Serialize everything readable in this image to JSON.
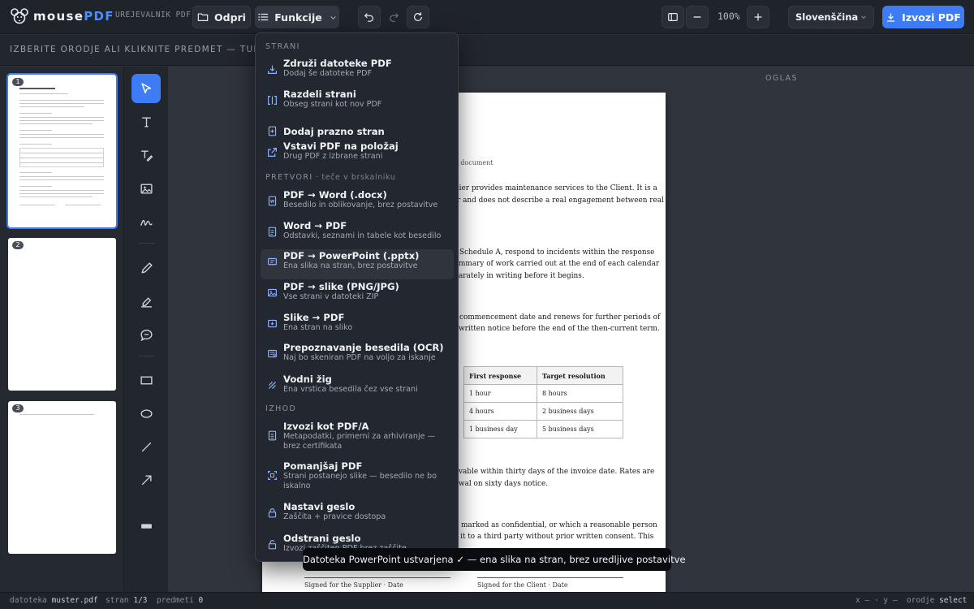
{
  "app": {
    "name_part1": "mouse",
    "name_part2": "PDF",
    "subtitle": "UREJEVALNIK PDF"
  },
  "toolbar": {
    "open_label": "Odpri",
    "functions_label": "Funkcije",
    "zoom": "100%",
    "language": "Slovenščina",
    "export_label": "Izvozi PDF"
  },
  "hint": "IZBERITE ORODJE ALI KLIKNITE PREDMET — TUKAJ SE PRI",
  "thumbnails": [
    "1",
    "2",
    "3"
  ],
  "ad_label": "OGLAS",
  "menu": {
    "sections": [
      {
        "title": "STRANI",
        "note": "",
        "items": [
          {
            "title": "Združi datoteke PDF",
            "sub": "Dodaj še datoteke PDF",
            "icon": "merge-icon"
          },
          {
            "title": "Razdeli strani",
            "sub": "Obseg strani kot nov PDF",
            "icon": "split-icon"
          },
          {
            "title": "Dodaj prazno stran",
            "sub": "",
            "icon": "add-page-icon"
          },
          {
            "title": "Vstavi PDF na položaj",
            "sub": "Drug PDF z izbrane strani",
            "icon": "insert-icon"
          }
        ]
      },
      {
        "title": "PRETVORI",
        "note": " · teče v brskalniku",
        "items": [
          {
            "title": "PDF → Word (.docx)",
            "sub": "Besedilo in oblikovanje, brez postavitve",
            "icon": "word-icon"
          },
          {
            "title": "Word → PDF",
            "sub": "Odstavki, seznami in tabele kot besedilo",
            "icon": "pdf-file-icon"
          },
          {
            "title": "PDF → PowerPoint (.pptx)",
            "sub": "Ena slika na stran, brez postavitve",
            "icon": "slides-icon"
          },
          {
            "title": "PDF → slike (PNG/JPG)",
            "sub": "Vse strani v datoteki ZIP",
            "icon": "image-icon"
          },
          {
            "title": "Slike → PDF",
            "sub": "Ena stran na sliko",
            "icon": "images-to-pdf-icon"
          },
          {
            "title": "Prepoznavanje besedila (OCR)",
            "sub": "Naj bo skeniran PDF na voljo za iskanje",
            "icon": "ocr-icon"
          },
          {
            "title": "Vodni žig",
            "sub": "Ena vrstica besedila čez vse strani",
            "icon": "watermark-icon"
          }
        ]
      },
      {
        "title": "IZHOD",
        "note": "",
        "items": [
          {
            "title": "Izvozi kot PDF/A",
            "sub": "Metapodatki, primerni za arhiviranje — brez certifikata",
            "icon": "archive-icon"
          },
          {
            "title": "Pomanjšaj PDF",
            "sub": "Strani postanejo slike — besedilo ne bo iskalno",
            "icon": "compress-icon"
          },
          {
            "title": "Nastavi geslo",
            "sub": "Zaščita + pravice dostopa",
            "icon": "lock-icon"
          },
          {
            "title": "Odstrani geslo",
            "sub": "Izvozi zaščiten PDF brez zaščite",
            "icon": "unlock-icon"
          }
        ]
      }
    ]
  },
  "document": {
    "doc_fragment": "e document",
    "p1": [
      "llier provides maintenance services to the Client. It is a",
      "r and does not describe a real engagement between real"
    ],
    "p2": [
      "Schedule A, respond to incidents within the response",
      "mmary of work carried out at the end of each calendar",
      "arately in writing before it begins."
    ],
    "p3": [
      "commencement date and renews for further periods of",
      "written notice before the end of the then-current term."
    ],
    "table_header": [
      "First response",
      "Target resolution"
    ],
    "table_rows": [
      [
        "1 hour",
        "8 hours"
      ],
      [
        "4 hours",
        "2 business days"
      ],
      [
        "1 business day",
        "5 business days"
      ]
    ],
    "p4": [
      "vable within thirty days of the invoice date. Rates are",
      "wal on sixty days notice."
    ],
    "p5": [
      "marked as confidential, or which a reasonable person",
      "it to a third party without prior written consent. This"
    ],
    "sig_supplier": "Signed for the Supplier · Date",
    "sig_client": "Signed for the Client · Date"
  },
  "toast": "Datoteka PowerPoint ustvarjena ✓ — ena slika na stran, brez uredljive postavitve",
  "status": {
    "file_label": "datoteka",
    "file_name": "muster.pdf",
    "page_label": "stran",
    "page_value": "1/3",
    "items_label": "predmeti",
    "items_value": "0",
    "coords": "x — · y —",
    "mode_label": "orodje",
    "mode_value": "select"
  },
  "colors": {
    "accent": "#3d7cf5",
    "topbar": "#1f232a",
    "menu_bg": "#23272f"
  }
}
